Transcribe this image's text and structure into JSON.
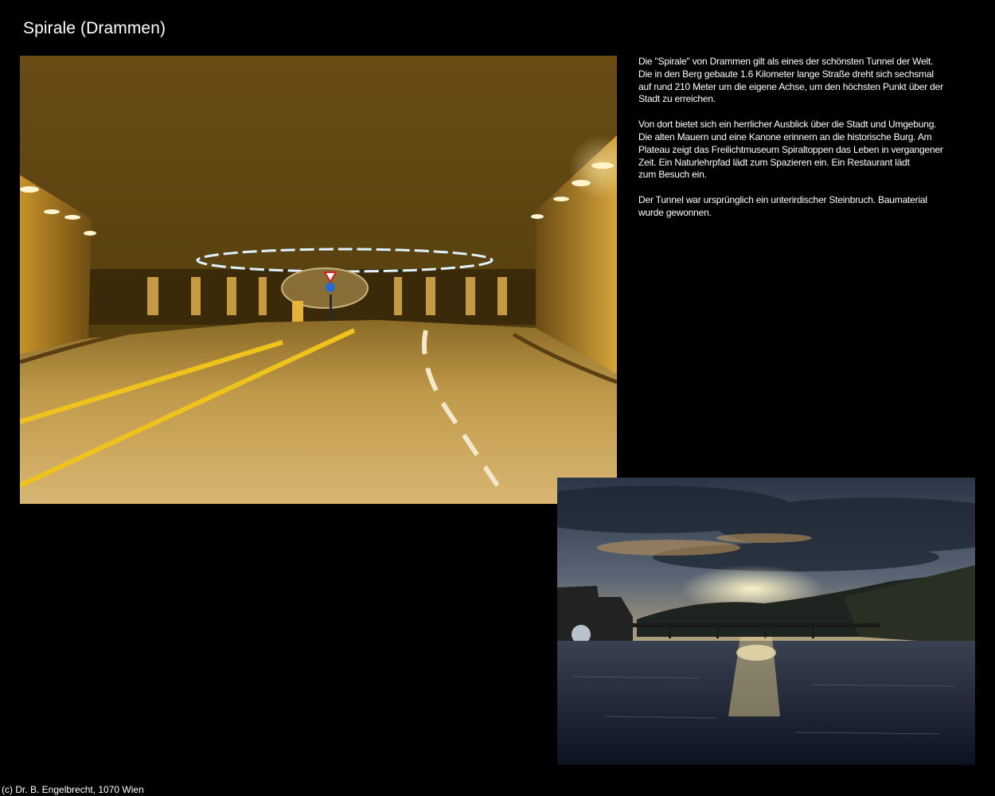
{
  "page": {
    "title": "Spirale (Drammen)",
    "footer": "(c) Dr. B. Engelbrecht, 1070 Wien"
  },
  "description": {
    "paragraphs": [
      "Die \"Spirale\" von Drammen gilt als eines der schönsten Tunnel der Welt.\nDie in den Berg gebaute 1.6 Kilometer lange Straße dreht sich sechsmal\nauf rund 210 Meter um die eigene Achse, um den höchsten Punkt über der\nStadt zu erreichen.",
      "Von dort bietet sich ein herrlicher Ausblick über die Stadt und Umgebung.\nDie alten Mauern und eine Kanone erinnern an die historische Burg. Am\nPlateau zeigt das Freilichtmuseum Spiraltoppen das Leben in vergangener\nZeit. Ein Naturlehrpfad lädt zum Spazieren ein. Ein Restaurant lädt\nzum Besuch ein.",
      "Der Tunnel war ursprünglich ein unterirdischer Steinbruch. Baumaterial\nwurde gewonnen."
    ]
  },
  "colors": {
    "background": "#000000",
    "text": "#ffffff",
    "tunnel_light": "#e8c25a",
    "sunset_sky": "#f2d27a"
  }
}
